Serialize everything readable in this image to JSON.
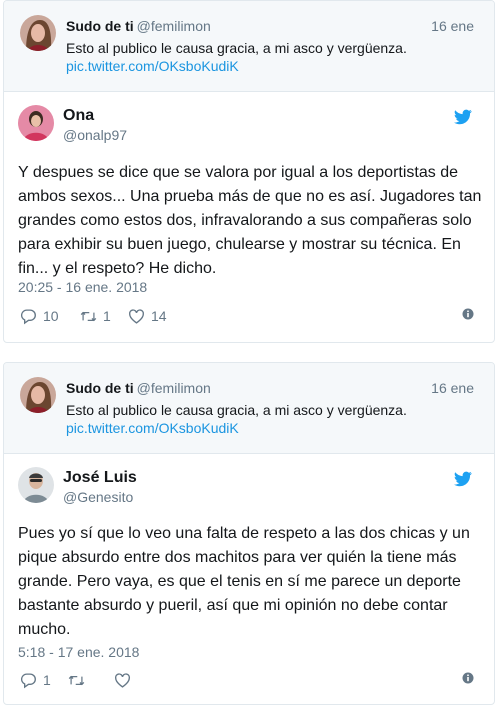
{
  "colors": {
    "link": "#1b95e0",
    "secondary": "#657786",
    "twitter_blue": "#1da1f2",
    "quote_bg": "#f5f8fa",
    "border": "#e1e8ed"
  },
  "tweets": [
    {
      "quoted": {
        "name": "Sudo de ti",
        "handle": "@femilimon",
        "date": "16 ene",
        "text": "Esto al publico le causa gracia, a mi asco y vergüenza.",
        "link": "pic.twitter.com/OKsboKudiK"
      },
      "author": {
        "name": "Ona",
        "handle": "@onalp97"
      },
      "text": "Y despues se dice que se valora por igual a los deportistas de ambos sexos... Una prueba más de que no es así. Jugadores tan grandes como estos dos, infravalorando a sus compañeras solo para exhibir su buen juego, chulearse y mostrar su técnica. En fin... y el respeto? He dicho.",
      "timestamp": "20:25 - 16 ene. 2018",
      "replies": "10",
      "retweets": "1",
      "likes": "14",
      "icons": [
        "reply-icon",
        "retweet-icon",
        "heart-icon",
        "info-icon",
        "twitter-bird-icon"
      ]
    },
    {
      "quoted": {
        "name": "Sudo de ti",
        "handle": "@femilimon",
        "date": "16 ene",
        "text": "Esto al publico le causa gracia, a mi asco y vergüenza.",
        "link": "pic.twitter.com/OKsboKudiK"
      },
      "author": {
        "name": "José Luis",
        "handle": "@Genesito"
      },
      "text": "Pues yo sí que lo veo una falta de respeto a las dos chicas y un pique absurdo entre dos machitos para ver quién la tiene más grande. Pero vaya, es que el tenis en sí me parece un deporte bastante absurdo y pueril, así que mi opinión no debe contar mucho.",
      "timestamp": "5:18 - 17 ene. 2018",
      "replies": "1",
      "retweets": "",
      "likes": "",
      "icons": [
        "reply-icon",
        "retweet-icon",
        "heart-icon",
        "info-icon",
        "twitter-bird-icon"
      ]
    }
  ]
}
